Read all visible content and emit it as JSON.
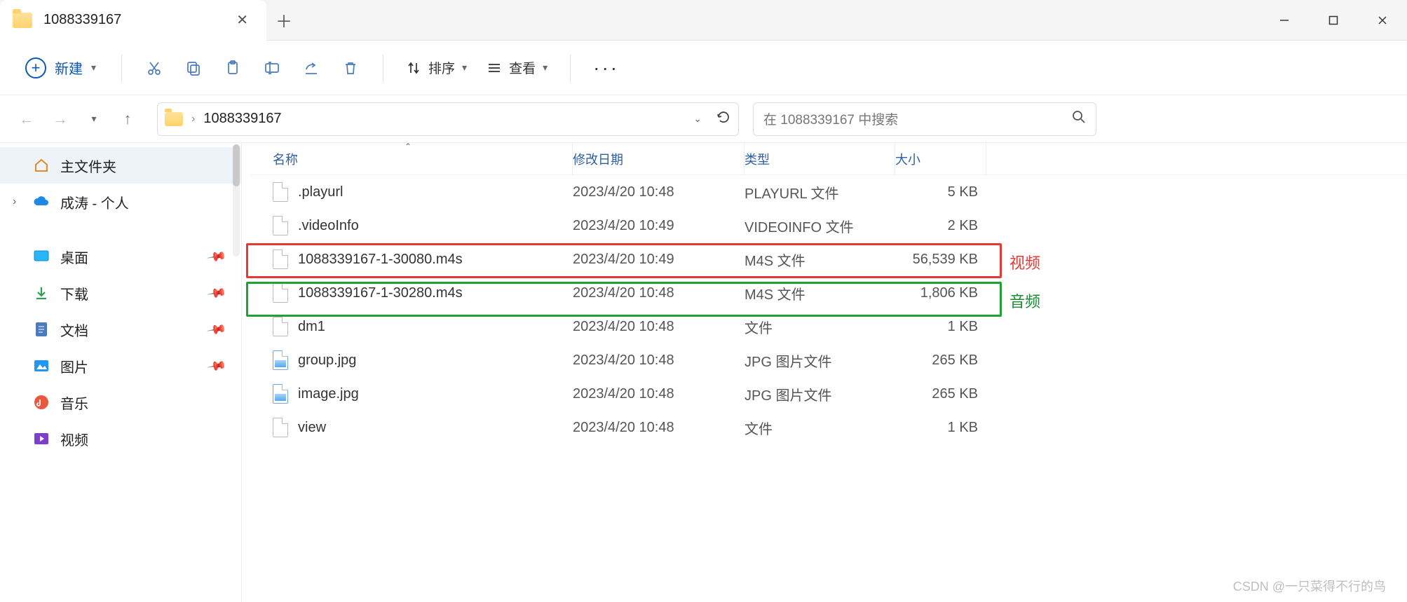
{
  "tab": {
    "title": "1088339167"
  },
  "toolbar": {
    "new_label": "新建",
    "sort_label": "排序",
    "view_label": "查看"
  },
  "address": {
    "path": "1088339167",
    "search_placeholder": "在 1088339167 中搜索"
  },
  "sidebar": {
    "home": "主文件夹",
    "onedrive": "成涛 - 个人",
    "quick": [
      {
        "label": "桌面"
      },
      {
        "label": "下载"
      },
      {
        "label": "文档"
      },
      {
        "label": "图片"
      },
      {
        "label": "音乐"
      },
      {
        "label": "视频"
      }
    ]
  },
  "columns": {
    "name": "名称",
    "date": "修改日期",
    "type": "类型",
    "size": "大小"
  },
  "files": [
    {
      "name": ".playurl",
      "date": "2023/4/20 10:48",
      "type": "PLAYURL 文件",
      "size": "5 KB",
      "icon": "file"
    },
    {
      "name": ".videoInfo",
      "date": "2023/4/20 10:49",
      "type": "VIDEOINFO 文件",
      "size": "2 KB",
      "icon": "file"
    },
    {
      "name": "1088339167-1-30080.m4s",
      "date": "2023/4/20 10:49",
      "type": "M4S 文件",
      "size": "56,539 KB",
      "icon": "file",
      "hl": "red"
    },
    {
      "name": "1088339167-1-30280.m4s",
      "date": "2023/4/20 10:48",
      "type": "M4S 文件",
      "size": "1,806 KB",
      "icon": "file",
      "hl": "green"
    },
    {
      "name": "dm1",
      "date": "2023/4/20 10:48",
      "type": "文件",
      "size": "1 KB",
      "icon": "file"
    },
    {
      "name": "group.jpg",
      "date": "2023/4/20 10:48",
      "type": "JPG 图片文件",
      "size": "265 KB",
      "icon": "jpg"
    },
    {
      "name": "image.jpg",
      "date": "2023/4/20 10:48",
      "type": "JPG 图片文件",
      "size": "265 KB",
      "icon": "jpg"
    },
    {
      "name": "view",
      "date": "2023/4/20 10:48",
      "type": "文件",
      "size": "1 KB",
      "icon": "file"
    }
  ],
  "annotations": {
    "video": "视频",
    "audio": "音频"
  },
  "watermark": "CSDN @一只菜得不行的鸟"
}
